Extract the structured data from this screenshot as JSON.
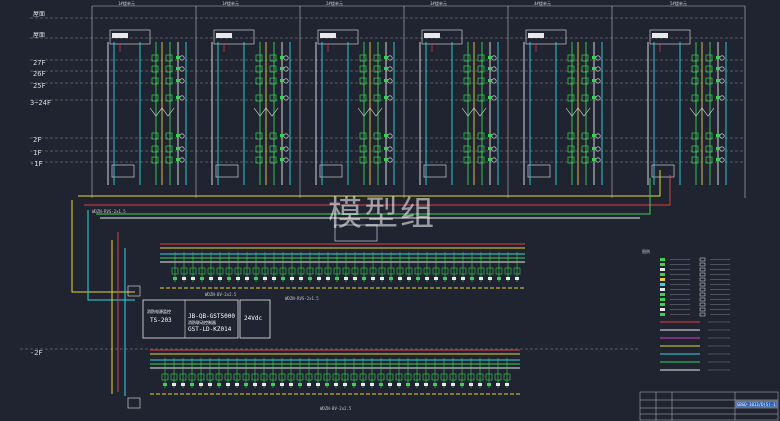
{
  "watermark": "模型组",
  "floors": [
    "27F",
    "26F",
    "25F",
    "3~24F",
    "2F",
    "1F",
    "-1F"
  ],
  "basement_floor": "-2F",
  "roof_level_label": "屋面",
  "column_headers": [
    "1#楼单元",
    "1#楼单元",
    "2#楼单元",
    "3#楼单元",
    "4#楼单元",
    "5#楼单元"
  ],
  "controller": {
    "model_line1": "JB-QB-GST5000",
    "model_line2": "消防联动控制器",
    "panel": "GST-LD-KZ014",
    "left_label": "消防电源监控",
    "left_code": "TS-203",
    "power": "24Vdc"
  },
  "legend_title": "图例",
  "title_block_code": "GBGD-1013/D(S)-1",
  "wire_labels": [
    "WDZN-RVS-2x1.5",
    "WDZN-BV-2x2.5",
    "WDZN-RVS-2x1.5",
    "WDZN-BV-2x2.5"
  ],
  "colors": {
    "background": "#1f2430",
    "cyan": "#2fd6e0",
    "green": "#39d353",
    "yellow": "#e8d23a",
    "red": "#e23b3b",
    "white": "#e8e8e8",
    "magenta": "#d03fd0"
  }
}
